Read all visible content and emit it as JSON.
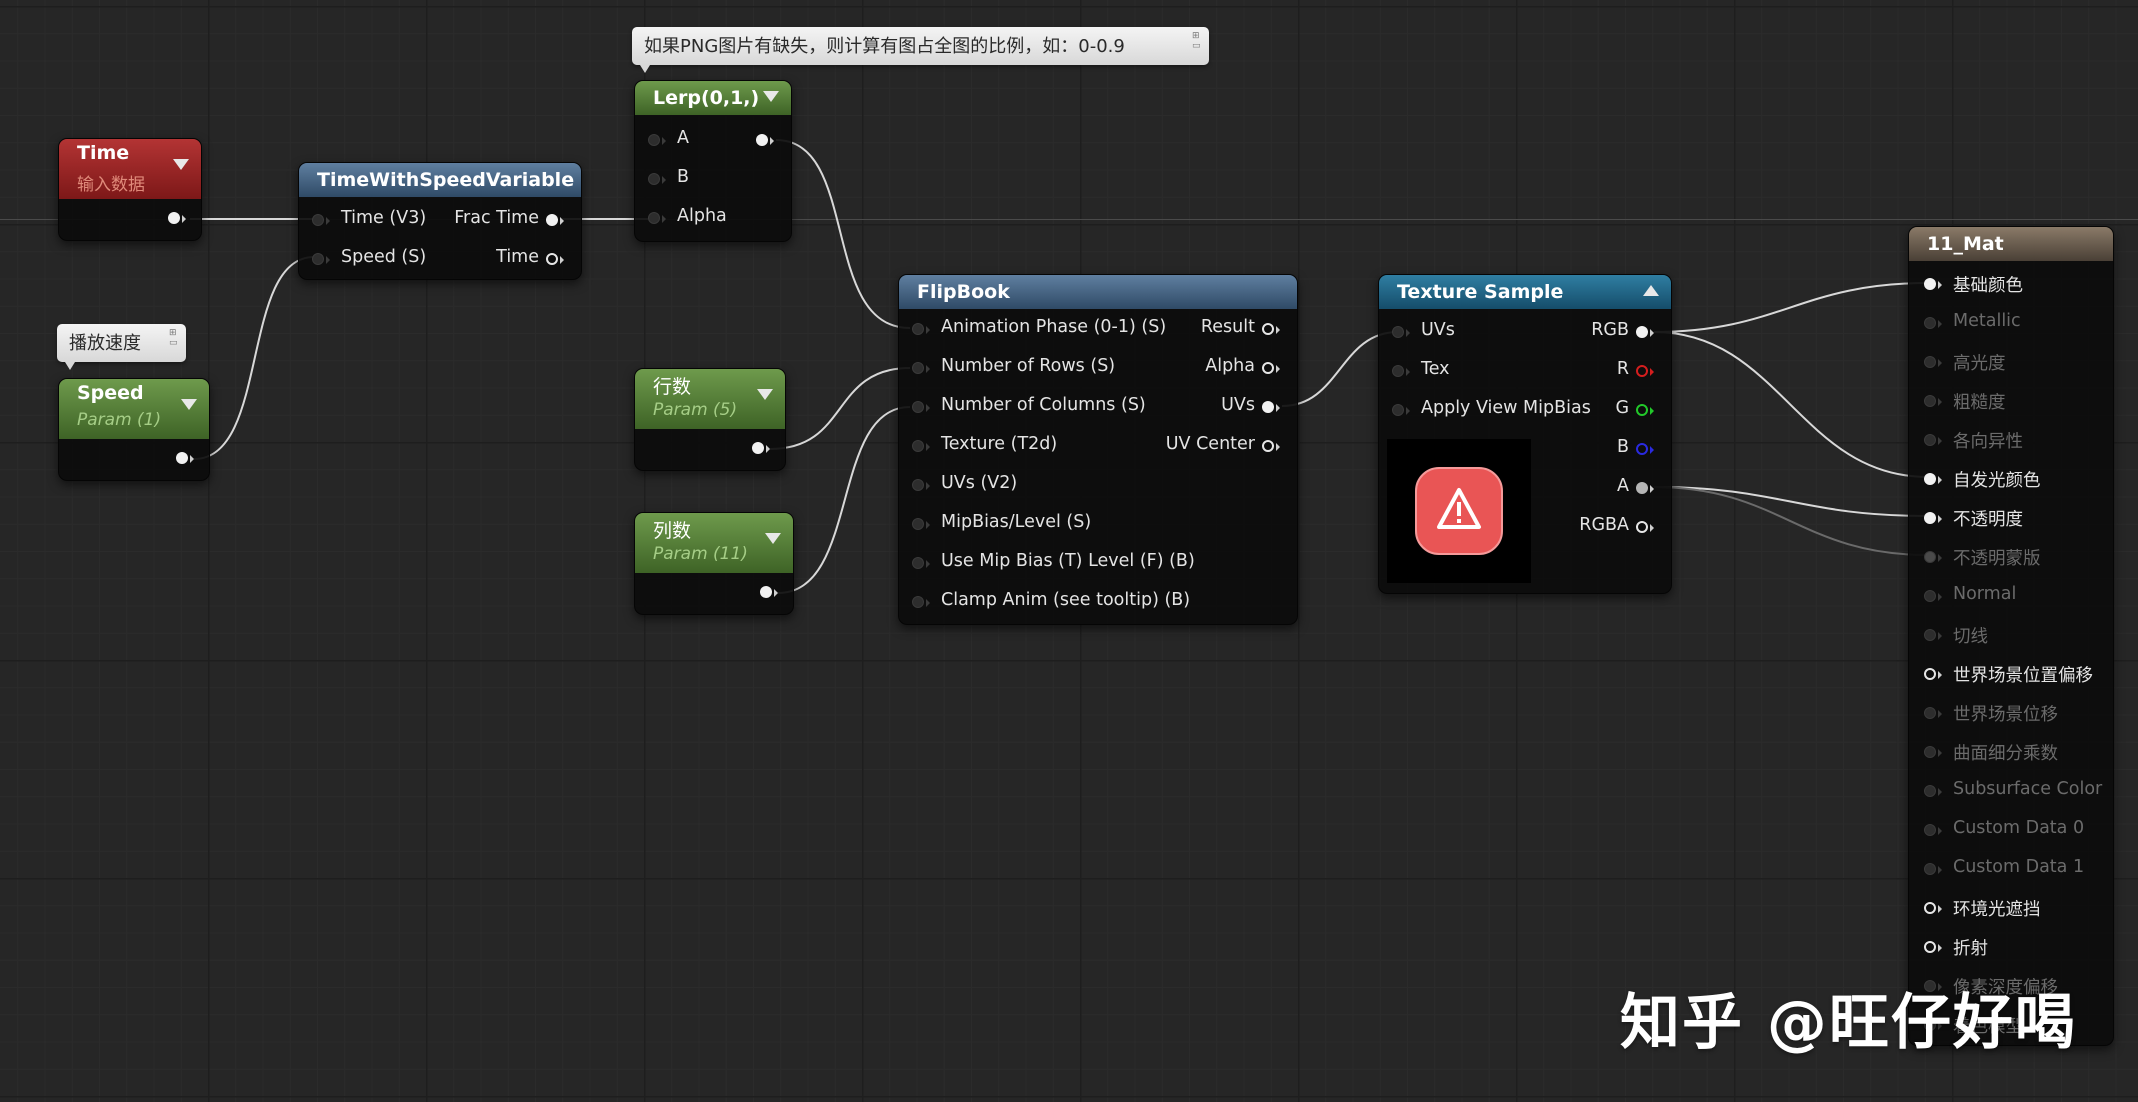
{
  "comments": {
    "lerp_note": "如果PNG图片有缺失，则计算有图占全图的比例，如：0-0.9",
    "speed_note": "播放速度"
  },
  "nodes": {
    "time": {
      "title": "Time",
      "subtitle": "输入数据"
    },
    "speed": {
      "title": "Speed",
      "subtitle": "Param (1)"
    },
    "tws": {
      "title": "TimeWithSpeedVariable",
      "in": [
        "Time (V3)",
        "Speed (S)"
      ],
      "out": [
        "Frac Time",
        "Time"
      ]
    },
    "lerp": {
      "title": "Lerp(0,1,)",
      "in": [
        "A",
        "B",
        "Alpha"
      ]
    },
    "rows": {
      "title": "行数",
      "subtitle": "Param (5)"
    },
    "cols": {
      "title": "列数",
      "subtitle": "Param (11)"
    },
    "flipbook": {
      "title": "FlipBook",
      "in": [
        "Animation  Phase (0-1) (S)",
        "Number of Rows (S)",
        "Number of Columns (S)",
        "Texture (T2d)",
        "UVs (V2)",
        "MipBias/Level (S)",
        "Use Mip Bias (T) Level (F) (B)",
        "Clamp Anim (see tooltip) (B)"
      ],
      "out": [
        "Result",
        "Alpha",
        "UVs",
        "UV Center"
      ]
    },
    "texture": {
      "title": "Texture Sample",
      "in": [
        "UVs",
        "Tex",
        "Apply View MipBias"
      ],
      "out": [
        "RGB",
        "R",
        "G",
        "B",
        "A",
        "RGBA"
      ]
    },
    "material": {
      "title": "11_Mat",
      "pins": [
        "基础颜色",
        "Metallic",
        "高光度",
        "粗糙度",
        "各向异性",
        "自发光颜色",
        "不透明度",
        "不透明蒙版",
        "Normal",
        "切线",
        "世界场景位置偏移",
        "世界场景位移",
        "曲面细分乘数",
        "Subsurface Color",
        "Custom Data 0",
        "Custom Data 1",
        "环境光遮挡",
        "折射",
        "像素深度偏移",
        "着色模型"
      ]
    }
  },
  "watermark": "知乎 @旺仔好喝",
  "colors": {
    "time_header": "#9b2727",
    "param_header": "#55803a",
    "function_header": "#4a6a8a",
    "texture_header": "#22688a",
    "material_header": "#6a5e52",
    "wire": "#d8d8d8"
  }
}
